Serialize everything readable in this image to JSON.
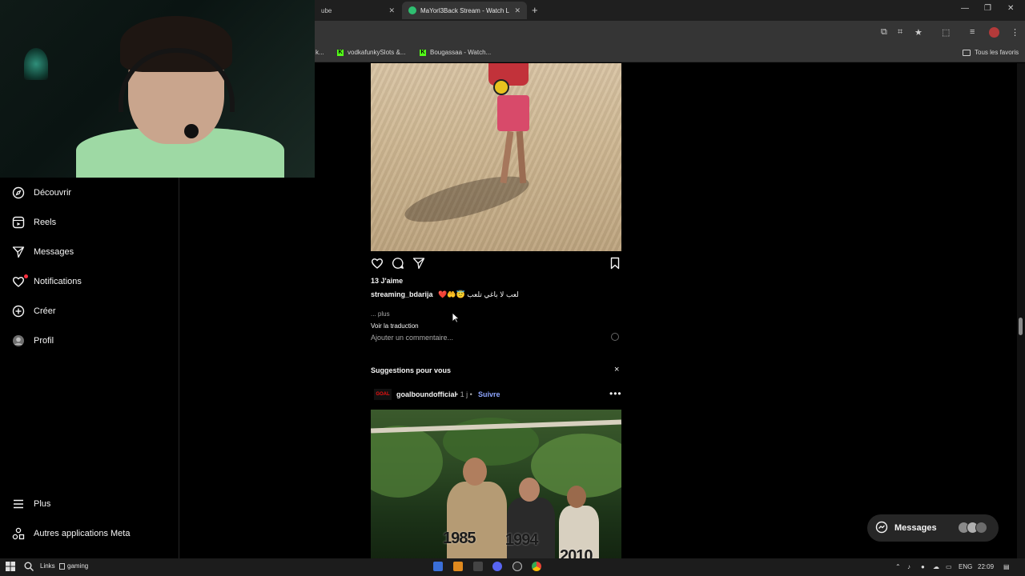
{
  "browser": {
    "tabs": [
      {
        "label": "ube",
        "active": false
      },
      {
        "label": "MaYorl3Back Stream - Watch L",
        "active": false
      }
    ],
    "new_tab_symbol": "+",
    "bookmarks": [
      {
        "label": "k..."
      },
      {
        "label": "vodkafunkySlots &..."
      },
      {
        "label": "Bougassaa - Watch..."
      }
    ],
    "all_bookmarks_label": "Tous les favoris"
  },
  "sidebar": {
    "items": [
      {
        "label": "Découvrir",
        "icon": "compass-icon"
      },
      {
        "label": "Reels",
        "icon": "reels-icon"
      },
      {
        "label": "Messages",
        "icon": "send-icon"
      },
      {
        "label": "Notifications",
        "icon": "heart-icon"
      },
      {
        "label": "Créer",
        "icon": "plus-square-icon"
      },
      {
        "label": "Profil",
        "icon": "avatar-icon"
      }
    ],
    "bottom_items": [
      {
        "label": "Plus",
        "icon": "menu-icon"
      },
      {
        "label": "Autres applications Meta",
        "icon": "meta-apps-icon"
      }
    ]
  },
  "post": {
    "likes": "13 J'aime",
    "username": "streaming_bdarija",
    "caption_emojis": "❤️🤲😇",
    "caption_text": "لعب لا باغي تلعب",
    "more_label": "... plus",
    "translate_label": "Voir la traduction",
    "comment_placeholder": "Ajouter un commentaire..."
  },
  "suggestions": {
    "title": "Suggestions pour vous",
    "close_symbol": "×",
    "account": {
      "username": "goalboundofficial",
      "avatar_text": "GOAL",
      "meta": "• 1 j •",
      "follow_label": "Suivre"
    },
    "image_years": [
      "1985",
      "1994",
      "2010"
    ]
  },
  "messages_pill": {
    "label": "Messages"
  },
  "taskbar": {
    "links_label": "Links",
    "gaming_label": "gaming",
    "language": "ENG",
    "time": "22:09"
  },
  "colors": {
    "background": "#000000",
    "follow_link": "#8ea5ff",
    "notification_dot": "#ff3040",
    "kick_green": "#53fc18"
  }
}
